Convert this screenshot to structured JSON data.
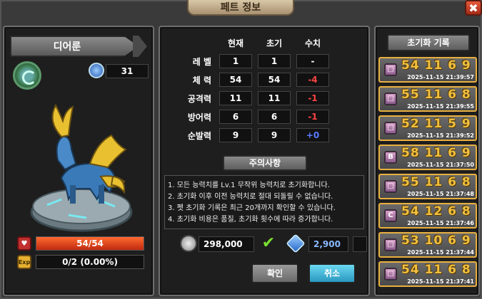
{
  "window": {
    "title": "페트 정보",
    "close_icon": "close-icon"
  },
  "pet": {
    "name": "디어룬",
    "level": "31",
    "hp_text": "54/54",
    "hp_fraction": 1.0,
    "exp_text": "0/2 (0.00%)",
    "exp_fraction": 0.0,
    "hp_icon": "heart-icon",
    "exp_icon": "exp-icon",
    "hp_label": "♥",
    "exp_label": "Exp"
  },
  "stats": {
    "headers": [
      "현재",
      "초기",
      "수치"
    ],
    "rows": [
      {
        "label": "레 벨",
        "current": "1",
        "initial": "1",
        "diff": "-",
        "diff_color": "#ffffff"
      },
      {
        "label": "체 력",
        "current": "54",
        "initial": "54",
        "diff": "-4",
        "diff_color": "#ff4444"
      },
      {
        "label": "공격력",
        "current": "11",
        "initial": "11",
        "diff": "-1",
        "diff_color": "#ff4444"
      },
      {
        "label": "방어력",
        "current": "6",
        "initial": "6",
        "diff": "-1",
        "diff_color": "#ff4444"
      },
      {
        "label": "순발력",
        "current": "9",
        "initial": "9",
        "diff": "+0",
        "diff_color": "#5a7aff"
      }
    ]
  },
  "notice": {
    "title": "주의사항",
    "lines": [
      "1. 모든 능력치를 Lv.1 무작위 능력치로 초기화합니다.",
      "2. 초기화 이후 이전 능력치로 절대 되돌릴 수 없습니다.",
      "3. 펫 초기화 기록은 최근 20개까지 확인할 수 있습니다.",
      "4. 초기화 비용은 품질, 초기화 횟수에 따라 증가합니다."
    ]
  },
  "cost": {
    "gold": "298,000",
    "gem": "2,900",
    "gold_icon": "coin-icon",
    "gem_icon": "diamond-icon",
    "check_icon": "checkmark-icon"
  },
  "buttons": {
    "confirm": "확인",
    "cancel": "취소"
  },
  "history": {
    "title": "초기화 기록",
    "items": [
      {
        "nums": "54  11   6   9",
        "date": "2025-11-15 21:39:57",
        "icon": "□"
      },
      {
        "nums": "55  11   6   8",
        "date": "2025-11-15 21:39:55",
        "icon": "□"
      },
      {
        "nums": "52  11   5   9",
        "date": "2025-11-15 21:39:52",
        "icon": "□"
      },
      {
        "nums": "58  11   6   9",
        "date": "2025-11-15 21:37:50",
        "icon": "B"
      },
      {
        "nums": "55  11   6   8",
        "date": "2025-11-15 21:37:48",
        "icon": "□"
      },
      {
        "nums": "54 12   6   8",
        "date": "2025-11-15 21:37:46",
        "icon": "C"
      },
      {
        "nums": "53 10   6   9",
        "date": "2025-11-15 21:37:44",
        "icon": "□"
      },
      {
        "nums": "54  11   6   8",
        "date": "2025-11-15 21:37:41",
        "icon": "□"
      }
    ]
  }
}
